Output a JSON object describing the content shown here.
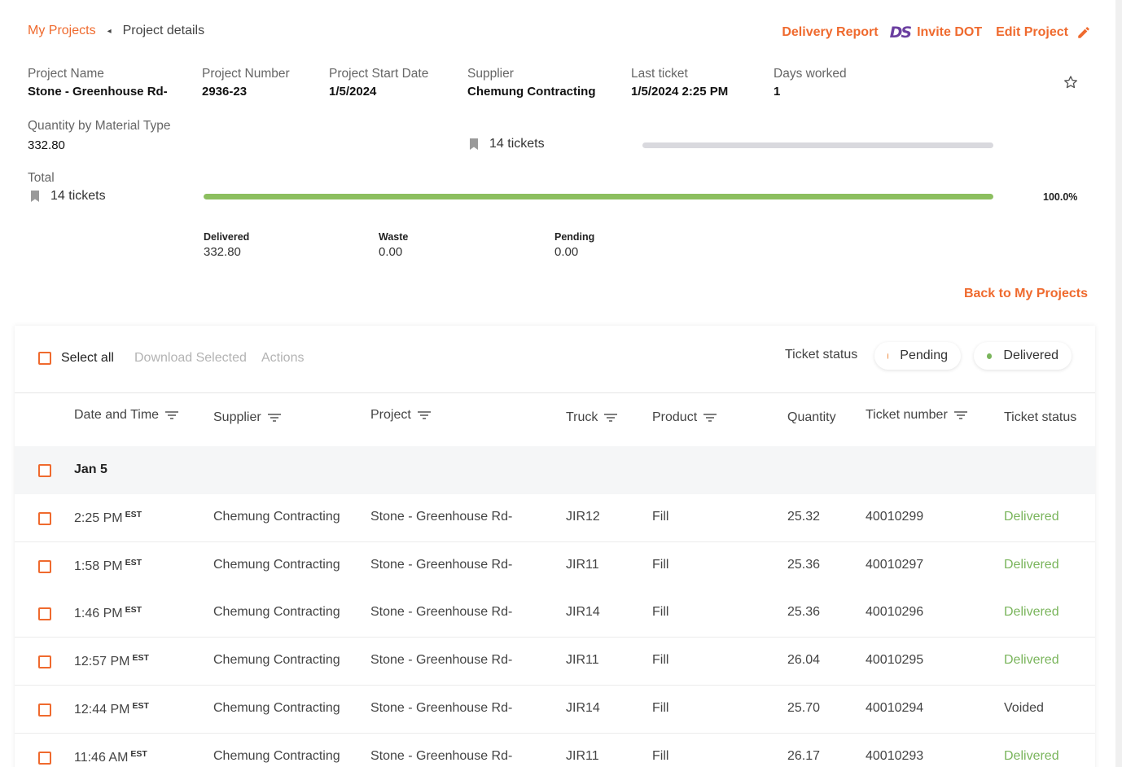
{
  "breadcrumb": {
    "root": "My Projects",
    "separator": "◂",
    "current": "Project details"
  },
  "top_actions": {
    "delivery_report": "Delivery Report",
    "ds_logo": "DS",
    "invite_dot": "Invite DOT",
    "edit_project": "Edit Project"
  },
  "project_info": {
    "name_label": "Project Name",
    "name_value": "Stone - Greenhouse Rd-",
    "number_label": "Project Number",
    "number_value": "2936-23",
    "start_label": "Project Start Date",
    "start_value": "1/5/2024",
    "supplier_label": "Supplier",
    "supplier_value": "Chemung Contracting",
    "last_ticket_label": "Last ticket",
    "last_ticket_value": "1/5/2024 2:25 PM",
    "days_label": "Days worked",
    "days_value": "1"
  },
  "quantity": {
    "label": "Quantity by Material Type",
    "value": "332.80",
    "tickets": "14 tickets",
    "progress_fraction": 0
  },
  "total": {
    "label": "Total",
    "tickets": "14 tickets",
    "percent": "100.0%",
    "progress_fraction": 1.0,
    "bar_color": "#8cbf5f"
  },
  "stats": {
    "delivered_label": "Delivered",
    "delivered_value": "332.80",
    "waste_label": "Waste",
    "waste_value": "0.00",
    "pending_label": "Pending",
    "pending_value": "0.00"
  },
  "back_link": "Back to My Projects",
  "toolbar": {
    "select_all": "Select all",
    "download_selected": "Download Selected",
    "actions": "Actions",
    "ticket_status_label": "Ticket status",
    "pending_pill": "Pending",
    "delivered_pill": "Delivered",
    "pending_color": "#ef8a3e",
    "delivered_color": "#7ab55c"
  },
  "table": {
    "headers": {
      "date_time": "Date and Time",
      "supplier": "Supplier",
      "project": "Project",
      "truck": "Truck",
      "product": "Product",
      "quantity": "Quantity",
      "ticket_number": "Ticket number",
      "ticket_status": "Ticket status"
    },
    "group_label": "Jan 5",
    "rows": [
      {
        "time": "2:25 PM",
        "tz": "EST",
        "supplier": "Chemung Contracting",
        "project": "Stone - Greenhouse Rd-",
        "truck": "JIR12",
        "product": "Fill",
        "quantity": "25.32",
        "ticket": "40010299",
        "status": "Delivered"
      },
      {
        "time": "1:58 PM",
        "tz": "EST",
        "supplier": "Chemung Contracting",
        "project": "Stone - Greenhouse Rd-",
        "truck": "JIR11",
        "product": "Fill",
        "quantity": "25.36",
        "ticket": "40010297",
        "status": "Delivered"
      },
      {
        "time": "1:46 PM",
        "tz": "EST",
        "supplier": "Chemung Contracting",
        "project": "Stone - Greenhouse Rd-",
        "truck": "JIR14",
        "product": "Fill",
        "quantity": "25.36",
        "ticket": "40010296",
        "status": "Delivered"
      },
      {
        "time": "12:57 PM",
        "tz": "EST",
        "supplier": "Chemung Contracting",
        "project": "Stone - Greenhouse Rd-",
        "truck": "JIR11",
        "product": "Fill",
        "quantity": "26.04",
        "ticket": "40010295",
        "status": "Delivered"
      },
      {
        "time": "12:44 PM",
        "tz": "EST",
        "supplier": "Chemung Contracting",
        "project": "Stone - Greenhouse Rd-",
        "truck": "JIR14",
        "product": "Fill",
        "quantity": "25.70",
        "ticket": "40010294",
        "status": "Voided"
      },
      {
        "time": "11:46 AM",
        "tz": "EST",
        "supplier": "Chemung Contracting",
        "project": "Stone - Greenhouse Rd-",
        "truck": "JIR11",
        "product": "Fill",
        "quantity": "26.17",
        "ticket": "40010293",
        "status": "Delivered"
      }
    ]
  },
  "icons": {
    "star": "star-outline-icon",
    "pencil": "pencil-icon",
    "bookmark": "bookmark-icon",
    "filter": "filter-lines-icon"
  },
  "colors": {
    "accent": "#ef6a2e",
    "delivered": "#7ab55c"
  }
}
